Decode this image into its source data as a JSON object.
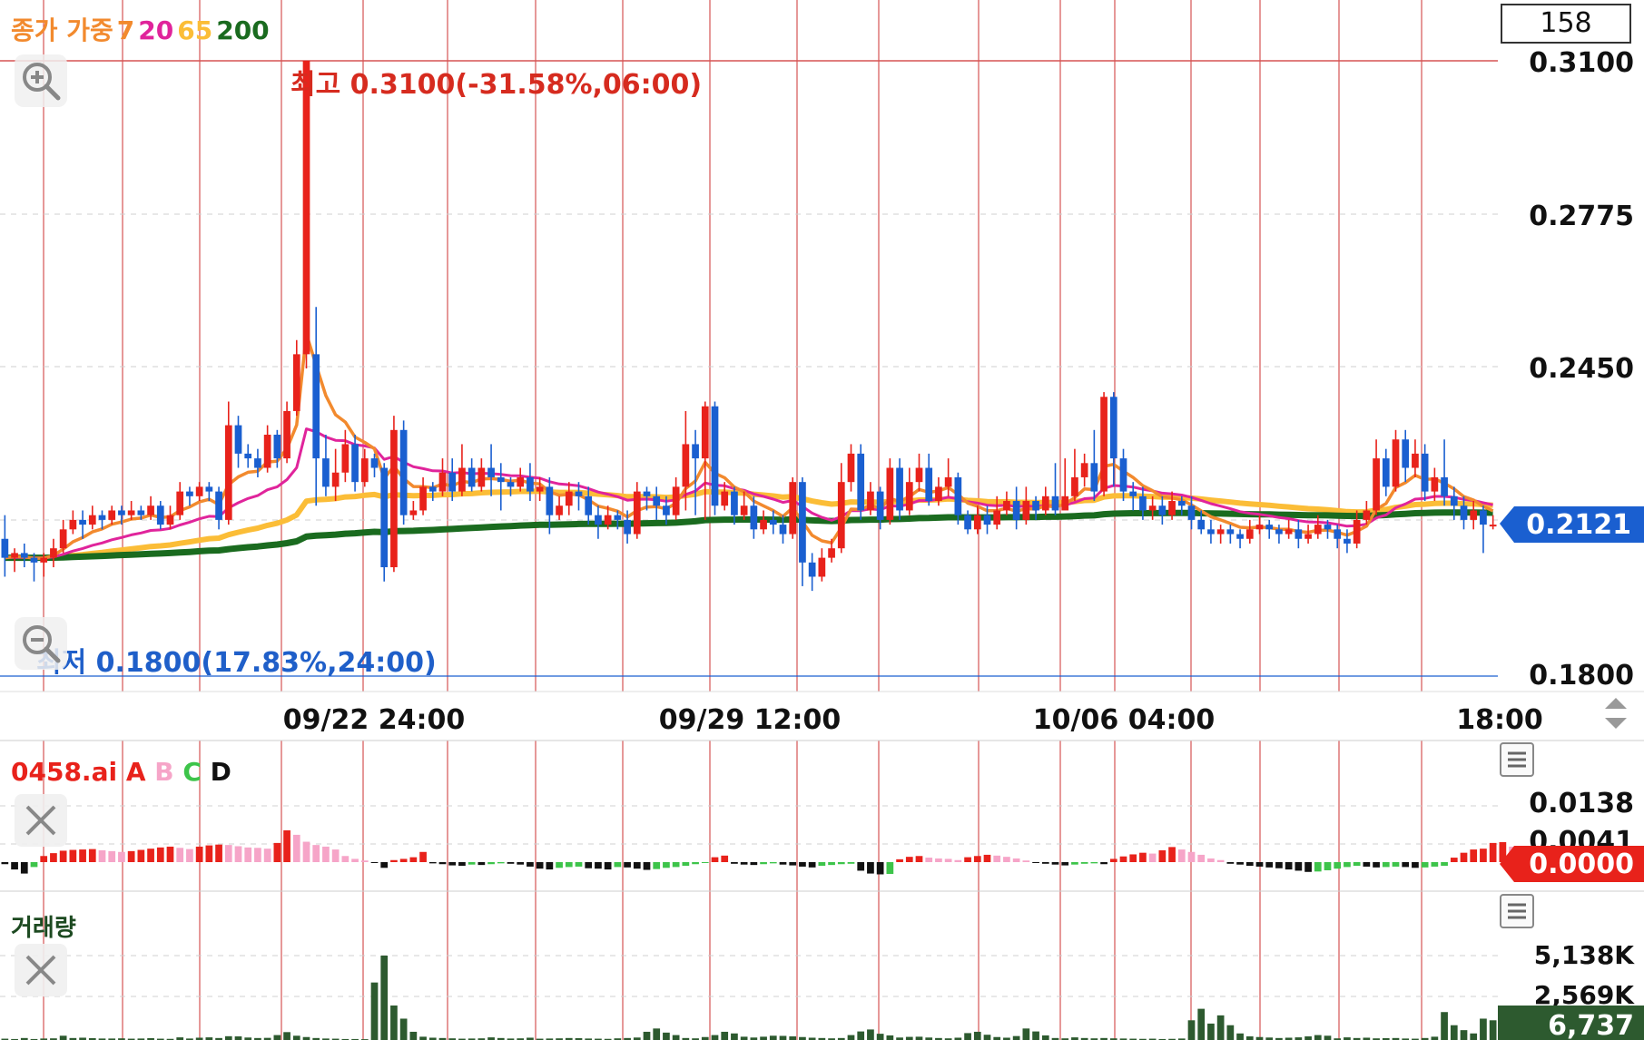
{
  "legend": {
    "prefix": "종가 가중",
    "ma7": "7",
    "ma20": "20",
    "ma65": "65",
    "ma200": "200"
  },
  "counter": "158",
  "high_label": "최고 0.3100(-31.58%,06:00)",
  "low_label": "최저 0.1800(17.83%,24:00)",
  "price_axis": [
    "0.3100",
    "0.2775",
    "0.2450",
    "0.1800"
  ],
  "current_price": "0.2121",
  "time_axis": [
    "09/22 24:00",
    "09/29 12:00",
    "10/06 04:00",
    "18:00"
  ],
  "indicator": {
    "name": "0458.ai",
    "a": "A",
    "b": "B",
    "c": "C",
    "d": "D",
    "axis": [
      "0.0138",
      "0.0041"
    ],
    "current": "0.0000"
  },
  "volume": {
    "title": "거래량",
    "axis": [
      "5,138K",
      "2,569K"
    ],
    "current": "6,737"
  },
  "colors": {
    "up": "#e8221b",
    "down": "#1a5fd0",
    "ma7": "#f28a2e",
    "ma20": "#e0249b",
    "ma65": "#fbbd37",
    "ma200": "#1a6b1f",
    "grid_red": "#d65454",
    "ind_red": "#e8221b",
    "ind_pink": "#f6a5c8",
    "ind_green": "#3dc44a",
    "ind_black": "#111111",
    "vol": "#2d5a2f",
    "price_badge": "#1a5fd0",
    "ind_badge": "#e8221b",
    "vol_badge": "#2d5a2f"
  },
  "icons": [
    "zoom-in-icon",
    "zoom-out-icon",
    "close-icon",
    "menu-icon",
    "updown-arrows-icon"
  ],
  "chart_data": {
    "type": "candlestick",
    "y_range": [
      0.18,
      0.31
    ],
    "high": 0.31,
    "low": 0.18,
    "last": 0.2121,
    "candles": [
      [
        0.209,
        0.205,
        0.214,
        0.201
      ],
      [
        0.205,
        0.206,
        0.207,
        0.202
      ],
      [
        0.206,
        0.205,
        0.208,
        0.203
      ],
      [
        0.205,
        0.204,
        0.206,
        0.2
      ],
      [
        0.204,
        0.205,
        0.206,
        0.201
      ],
      [
        0.205,
        0.207,
        0.209,
        0.203
      ],
      [
        0.207,
        0.211,
        0.213,
        0.206
      ],
      [
        0.211,
        0.213,
        0.215,
        0.21
      ],
      [
        0.213,
        0.212,
        0.215,
        0.209
      ],
      [
        0.212,
        0.214,
        0.216,
        0.211
      ],
      [
        0.214,
        0.213,
        0.215,
        0.211
      ],
      [
        0.213,
        0.215,
        0.216,
        0.212
      ],
      [
        0.215,
        0.214,
        0.216,
        0.212
      ],
      [
        0.214,
        0.215,
        0.217,
        0.213
      ],
      [
        0.215,
        0.214,
        0.216,
        0.213
      ],
      [
        0.214,
        0.216,
        0.218,
        0.213
      ],
      [
        0.216,
        0.212,
        0.217,
        0.211
      ],
      [
        0.212,
        0.214,
        0.216,
        0.211
      ],
      [
        0.214,
        0.219,
        0.221,
        0.213
      ],
      [
        0.219,
        0.218,
        0.22,
        0.216
      ],
      [
        0.218,
        0.22,
        0.221,
        0.217
      ],
      [
        0.22,
        0.219,
        0.221,
        0.217
      ],
      [
        0.219,
        0.213,
        0.22,
        0.211
      ],
      [
        0.213,
        0.233,
        0.238,
        0.212
      ],
      [
        0.233,
        0.227,
        0.235,
        0.224
      ],
      [
        0.227,
        0.226,
        0.229,
        0.224
      ],
      [
        0.226,
        0.224,
        0.228,
        0.222
      ],
      [
        0.224,
        0.231,
        0.233,
        0.223
      ],
      [
        0.231,
        0.226,
        0.232,
        0.224
      ],
      [
        0.226,
        0.236,
        0.238,
        0.225
      ],
      [
        0.236,
        0.248,
        0.251,
        0.235
      ],
      [
        0.248,
        0.31,
        0.31,
        0.245
      ],
      [
        0.248,
        0.226,
        0.258,
        0.216
      ],
      [
        0.226,
        0.22,
        0.231,
        0.218
      ],
      [
        0.22,
        0.223,
        0.228,
        0.217
      ],
      [
        0.223,
        0.229,
        0.232,
        0.221
      ],
      [
        0.229,
        0.221,
        0.231,
        0.219
      ],
      [
        0.221,
        0.226,
        0.228,
        0.22
      ],
      [
        0.226,
        0.224,
        0.227,
        0.222
      ],
      [
        0.224,
        0.203,
        0.225,
        0.2
      ],
      [
        0.203,
        0.232,
        0.235,
        0.202
      ],
      [
        0.232,
        0.214,
        0.234,
        0.212
      ],
      [
        0.214,
        0.215,
        0.217,
        0.213
      ],
      [
        0.215,
        0.22,
        0.222,
        0.214
      ],
      [
        0.22,
        0.219,
        0.221,
        0.217
      ],
      [
        0.219,
        0.223,
        0.226,
        0.218
      ],
      [
        0.223,
        0.219,
        0.226,
        0.217
      ],
      [
        0.219,
        0.224,
        0.229,
        0.218
      ],
      [
        0.224,
        0.22,
        0.226,
        0.219
      ],
      [
        0.22,
        0.224,
        0.226,
        0.219
      ],
      [
        0.224,
        0.222,
        0.229,
        0.218
      ],
      [
        0.222,
        0.221,
        0.225,
        0.215
      ],
      [
        0.221,
        0.22,
        0.222,
        0.218
      ],
      [
        0.22,
        0.222,
        0.224,
        0.219
      ],
      [
        0.222,
        0.219,
        0.225,
        0.217
      ],
      [
        0.219,
        0.22,
        0.222,
        0.217
      ],
      [
        0.22,
        0.214,
        0.222,
        0.21
      ],
      [
        0.214,
        0.216,
        0.218,
        0.213
      ],
      [
        0.216,
        0.219,
        0.221,
        0.214
      ],
      [
        0.219,
        0.218,
        0.221,
        0.215
      ],
      [
        0.218,
        0.214,
        0.22,
        0.212
      ],
      [
        0.214,
        0.212,
        0.216,
        0.209
      ],
      [
        0.212,
        0.214,
        0.216,
        0.211
      ],
      [
        0.214,
        0.213,
        0.215,
        0.211
      ],
      [
        0.213,
        0.21,
        0.215,
        0.208
      ],
      [
        0.21,
        0.219,
        0.221,
        0.209
      ],
      [
        0.219,
        0.218,
        0.22,
        0.215
      ],
      [
        0.218,
        0.216,
        0.22,
        0.213
      ],
      [
        0.216,
        0.214,
        0.218,
        0.212
      ],
      [
        0.214,
        0.22,
        0.222,
        0.213
      ],
      [
        0.22,
        0.229,
        0.236,
        0.215
      ],
      [
        0.229,
        0.226,
        0.232,
        0.214
      ],
      [
        0.226,
        0.237,
        0.238,
        0.213
      ],
      [
        0.237,
        0.216,
        0.238,
        0.214
      ],
      [
        0.216,
        0.219,
        0.221,
        0.215
      ],
      [
        0.219,
        0.214,
        0.22,
        0.212
      ],
      [
        0.214,
        0.216,
        0.219,
        0.213
      ],
      [
        0.216,
        0.211,
        0.218,
        0.209
      ],
      [
        0.211,
        0.213,
        0.215,
        0.21
      ],
      [
        0.213,
        0.212,
        0.215,
        0.21
      ],
      [
        0.212,
        0.21,
        0.214,
        0.208
      ],
      [
        0.21,
        0.221,
        0.222,
        0.209
      ],
      [
        0.221,
        0.204,
        0.222,
        0.199
      ],
      [
        0.204,
        0.201,
        0.206,
        0.198
      ],
      [
        0.201,
        0.205,
        0.207,
        0.2
      ],
      [
        0.205,
        0.207,
        0.209,
        0.204
      ],
      [
        0.207,
        0.221,
        0.225,
        0.206
      ],
      [
        0.221,
        0.227,
        0.229,
        0.219
      ],
      [
        0.227,
        0.215,
        0.229,
        0.213
      ],
      [
        0.215,
        0.219,
        0.221,
        0.214
      ],
      [
        0.219,
        0.213,
        0.22,
        0.211
      ],
      [
        0.213,
        0.224,
        0.226,
        0.212
      ],
      [
        0.224,
        0.215,
        0.226,
        0.213
      ],
      [
        0.215,
        0.221,
        0.224,
        0.214
      ],
      [
        0.221,
        0.224,
        0.227,
        0.219
      ],
      [
        0.224,
        0.217,
        0.227,
        0.216
      ],
      [
        0.217,
        0.22,
        0.222,
        0.216
      ],
      [
        0.22,
        0.222,
        0.226,
        0.218
      ],
      [
        0.222,
        0.214,
        0.223,
        0.212
      ],
      [
        0.214,
        0.211,
        0.215,
        0.21
      ],
      [
        0.211,
        0.214,
        0.216,
        0.21
      ],
      [
        0.214,
        0.212,
        0.216,
        0.21
      ],
      [
        0.212,
        0.215,
        0.218,
        0.211
      ],
      [
        0.215,
        0.217,
        0.219,
        0.214
      ],
      [
        0.217,
        0.213,
        0.22,
        0.211
      ],
      [
        0.213,
        0.217,
        0.22,
        0.212
      ],
      [
        0.217,
        0.215,
        0.218,
        0.213
      ],
      [
        0.215,
        0.218,
        0.22,
        0.214
      ],
      [
        0.218,
        0.215,
        0.225,
        0.214
      ],
      [
        0.215,
        0.218,
        0.226,
        0.216
      ],
      [
        0.218,
        0.222,
        0.228,
        0.217
      ],
      [
        0.222,
        0.225,
        0.227,
        0.22
      ],
      [
        0.225,
        0.219,
        0.232,
        0.217
      ],
      [
        0.219,
        0.239,
        0.24,
        0.218
      ],
      [
        0.239,
        0.226,
        0.24,
        0.22
      ],
      [
        0.226,
        0.219,
        0.228,
        0.217
      ],
      [
        0.219,
        0.218,
        0.221,
        0.215
      ],
      [
        0.218,
        0.215,
        0.22,
        0.213
      ],
      [
        0.215,
        0.216,
        0.218,
        0.213
      ],
      [
        0.216,
        0.214,
        0.218,
        0.212
      ],
      [
        0.214,
        0.217,
        0.219,
        0.213
      ],
      [
        0.217,
        0.216,
        0.218,
        0.214
      ],
      [
        0.216,
        0.213,
        0.218,
        0.211
      ],
      [
        0.213,
        0.211,
        0.215,
        0.21
      ],
      [
        0.211,
        0.21,
        0.213,
        0.208
      ],
      [
        0.21,
        0.211,
        0.212,
        0.208
      ],
      [
        0.211,
        0.21,
        0.212,
        0.208
      ],
      [
        0.21,
        0.209,
        0.211,
        0.207
      ],
      [
        0.209,
        0.211,
        0.213,
        0.208
      ],
      [
        0.211,
        0.212,
        0.214,
        0.21
      ],
      [
        0.212,
        0.211,
        0.213,
        0.209
      ],
      [
        0.211,
        0.21,
        0.212,
        0.208
      ],
      [
        0.21,
        0.211,
        0.213,
        0.209
      ],
      [
        0.211,
        0.209,
        0.213,
        0.207
      ],
      [
        0.209,
        0.21,
        0.212,
        0.208
      ],
      [
        0.21,
        0.212,
        0.214,
        0.209
      ],
      [
        0.212,
        0.211,
        0.213,
        0.209
      ],
      [
        0.211,
        0.209,
        0.212,
        0.207
      ],
      [
        0.209,
        0.208,
        0.211,
        0.206
      ],
      [
        0.208,
        0.213,
        0.215,
        0.207
      ],
      [
        0.213,
        0.215,
        0.217,
        0.212
      ],
      [
        0.215,
        0.226,
        0.23,
        0.214
      ],
      [
        0.226,
        0.22,
        0.228,
        0.218
      ],
      [
        0.22,
        0.23,
        0.232,
        0.219
      ],
      [
        0.23,
        0.224,
        0.232,
        0.221
      ],
      [
        0.224,
        0.227,
        0.23,
        0.222
      ],
      [
        0.227,
        0.219,
        0.229,
        0.217
      ],
      [
        0.219,
        0.222,
        0.224,
        0.217
      ],
      [
        0.222,
        0.218,
        0.23,
        0.216
      ],
      [
        0.218,
        0.216,
        0.22,
        0.213
      ],
      [
        0.216,
        0.213,
        0.218,
        0.211
      ],
      [
        0.213,
        0.215,
        0.217,
        0.211
      ],
      [
        0.215,
        0.212,
        0.216,
        0.206
      ],
      [
        0.212,
        0.212,
        0.214,
        0.211
      ]
    ],
    "indicator_values": [
      -0.0005,
      -0.0018,
      -0.0028,
      -0.0012,
      0.0015,
      0.0022,
      0.0028,
      0.003,
      0.0031,
      0.0032,
      0.0029,
      0.0027,
      0.0025,
      0.0027,
      0.003,
      0.0033,
      0.0036,
      0.0038,
      0.0035,
      0.0032,
      0.0038,
      0.0041,
      0.0043,
      0.0042,
      0.0039,
      0.0036,
      0.0035,
      0.0033,
      0.0047,
      0.0078,
      0.0067,
      0.005,
      0.0042,
      0.0038,
      0.0031,
      0.0015,
      0.0008,
      0.0004,
      -0.0002,
      -0.0014,
      0.0005,
      0.0008,
      0.0012,
      0.0025,
      -0.0003,
      -0.0005,
      -0.0008,
      -0.0009,
      -0.0006,
      -0.0007,
      -0.0005,
      -0.0003,
      -0.0004,
      -0.0006,
      -0.0011,
      -0.0016,
      -0.0018,
      -0.0014,
      -0.0012,
      -0.0011,
      -0.0015,
      -0.0016,
      -0.0018,
      -0.0012,
      -0.0013,
      -0.0016,
      -0.0019,
      -0.0017,
      -0.0014,
      -0.0012,
      -0.0009,
      -0.0005,
      -0.0002,
      0.0012,
      0.0016,
      -0.0004,
      -0.0006,
      -0.0007,
      -0.0005,
      -0.0003,
      -0.0006,
      -0.0008,
      -0.0011,
      -0.0013,
      -0.0009,
      -0.0007,
      -0.0005,
      -0.0004,
      -0.0021,
      -0.0028,
      -0.003,
      -0.0029,
      0.0007,
      0.0013,
      0.0015,
      0.0011,
      0.0009,
      0.0008,
      0.0005,
      0.0012,
      0.0015,
      0.0018,
      0.0016,
      0.0013,
      0.0009,
      0.0004,
      -0.0002,
      -0.0004,
      -0.0006,
      -0.0008,
      -0.0006,
      -0.0004,
      -0.0003,
      -0.0005,
      0.0008,
      0.0014,
      0.0019,
      0.0023,
      0.0021,
      0.0029,
      0.0037,
      0.0031,
      0.0025,
      0.0018,
      0.0009,
      0.0005,
      -0.0004,
      -0.0006,
      -0.0009,
      -0.0011,
      -0.0013,
      -0.0015,
      -0.0018,
      -0.0021,
      -0.0024,
      -0.0023,
      -0.002,
      -0.0016,
      -0.0012,
      -0.0009,
      -0.0011,
      -0.0013,
      -0.0012,
      -0.0011,
      -0.0012,
      -0.0014,
      -0.0013,
      -0.0011,
      -0.0009,
      0.0011,
      0.0023,
      0.0031,
      0.0033,
      0.0047,
      0.0049,
      0.0038,
      0.0025,
      0.0014,
      -0.0006,
      -0.0008
    ],
    "volume_values": [
      80,
      60,
      120,
      60,
      90,
      100,
      260,
      120,
      140,
      110,
      90,
      90,
      100,
      80,
      90,
      110,
      80,
      70,
      160,
      90,
      140,
      160,
      120,
      230,
      220,
      150,
      120,
      130,
      300,
      480,
      260,
      180,
      120,
      90,
      80,
      60,
      60,
      50,
      3500,
      5138,
      2100,
      1300,
      500,
      200,
      140,
      120,
      100,
      80,
      90,
      100,
      160,
      120,
      90,
      100,
      140,
      80,
      90,
      100,
      120,
      110,
      90,
      80,
      70,
      100,
      120,
      150,
      500,
      700,
      450,
      300,
      120,
      100,
      180,
      300,
      500,
      400,
      200,
      150,
      200,
      260,
      250,
      220,
      180,
      140,
      120,
      100,
      120,
      300,
      520,
      640,
      380,
      280,
      150,
      190,
      200,
      150,
      120,
      100,
      140,
      420,
      500,
      320,
      180,
      140,
      240,
      700,
      520,
      280,
      120,
      100,
      160,
      120,
      100,
      120,
      100,
      90,
      80,
      70,
      80,
      60,
      70,
      90,
      1200,
      1900,
      1000,
      1500,
      900,
      400,
      220,
      180,
      150,
      120,
      140,
      160,
      220,
      300,
      260,
      100,
      160,
      120,
      140,
      100,
      110,
      120,
      90,
      80,
      120,
      200,
      1700,
      900,
      600,
      400,
      1300,
      1200,
      300,
      100,
      160
    ]
  }
}
